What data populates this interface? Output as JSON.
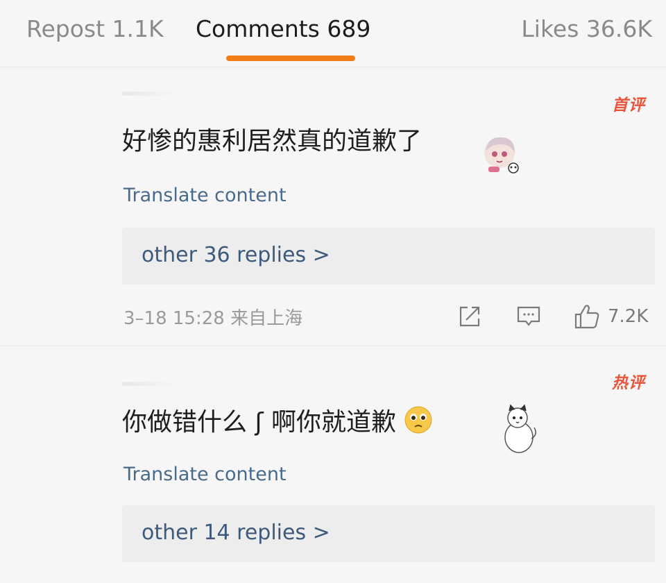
{
  "tabs": {
    "repost": "Repost 1.1K",
    "comments": "Comments 689",
    "likes": "Likes 36.6K"
  },
  "colors": {
    "accent": "#f07e18",
    "link": "#3d5a7d",
    "badge": "#e8553a"
  },
  "comments": [
    {
      "badge": "首评",
      "text": "好惨的惠利居然真的道歉了",
      "translate": "Translate content",
      "replies": "other 36 replies >",
      "timestamp": "3–18 15:28  来自上海",
      "likes": "7.2K",
      "sticker": "anime-girl-sticker"
    },
    {
      "badge": "热评",
      "text": "你做错什么 ʃ 啊你就道歉",
      "emoji": "pleading-face-emoji",
      "translate": "Translate content",
      "replies": "other 14 replies >",
      "sticker": "cartoon-cat-sticker"
    }
  ],
  "icons": {
    "share": "share-icon",
    "comment": "comment-icon",
    "like": "thumbs-up-icon"
  }
}
